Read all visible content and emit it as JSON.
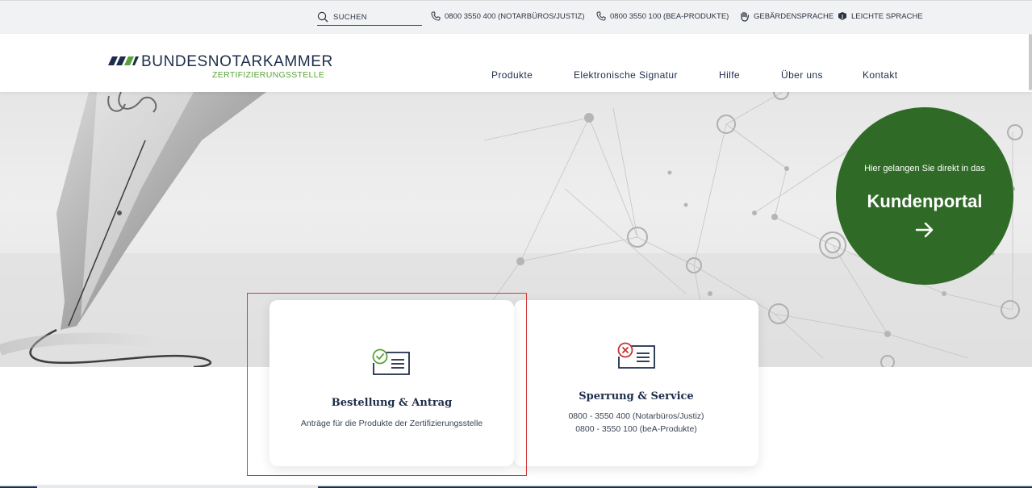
{
  "utility": {
    "search_label": "SUCHEN",
    "phone_notar": "0800 3550 400 (NOTARBÜROS/JUSTIZ)",
    "phone_bea": "0800 3550 100 (BEA-PRODUKTE)",
    "sign_language": "GEBÄRDENSPRACHE",
    "easy_language": "LEICHTE SPRACHE"
  },
  "brand": {
    "name": "BUNDESNOTARKAMMER",
    "subtitle": "ZERTIFIZIERUNGSSTELLE",
    "primary_color": "#1d2d4a",
    "accent_color": "#5aa33a"
  },
  "nav": {
    "items": [
      "Produkte",
      "Elektronische Signatur",
      "Hilfe",
      "Über uns",
      "Kontakt"
    ]
  },
  "portal": {
    "intro": "Hier gelangen Sie direkt in das",
    "title": "Kundenportal",
    "color": "#2f6b26",
    "icon": "arrow-right-icon"
  },
  "cards": [
    {
      "title": "Bestellung & Antrag",
      "description": "Anträge für die Produkte der Zertifizierungsstelle",
      "icon": "certificate-check-icon"
    },
    {
      "title": "Sperrung & Service",
      "line1": "0800 - 3550 400 (Notarbüros/Justiz)",
      "line2": "0800 - 3550 100 (beA-Produkte)",
      "icon": "certificate-revoke-icon"
    }
  ]
}
